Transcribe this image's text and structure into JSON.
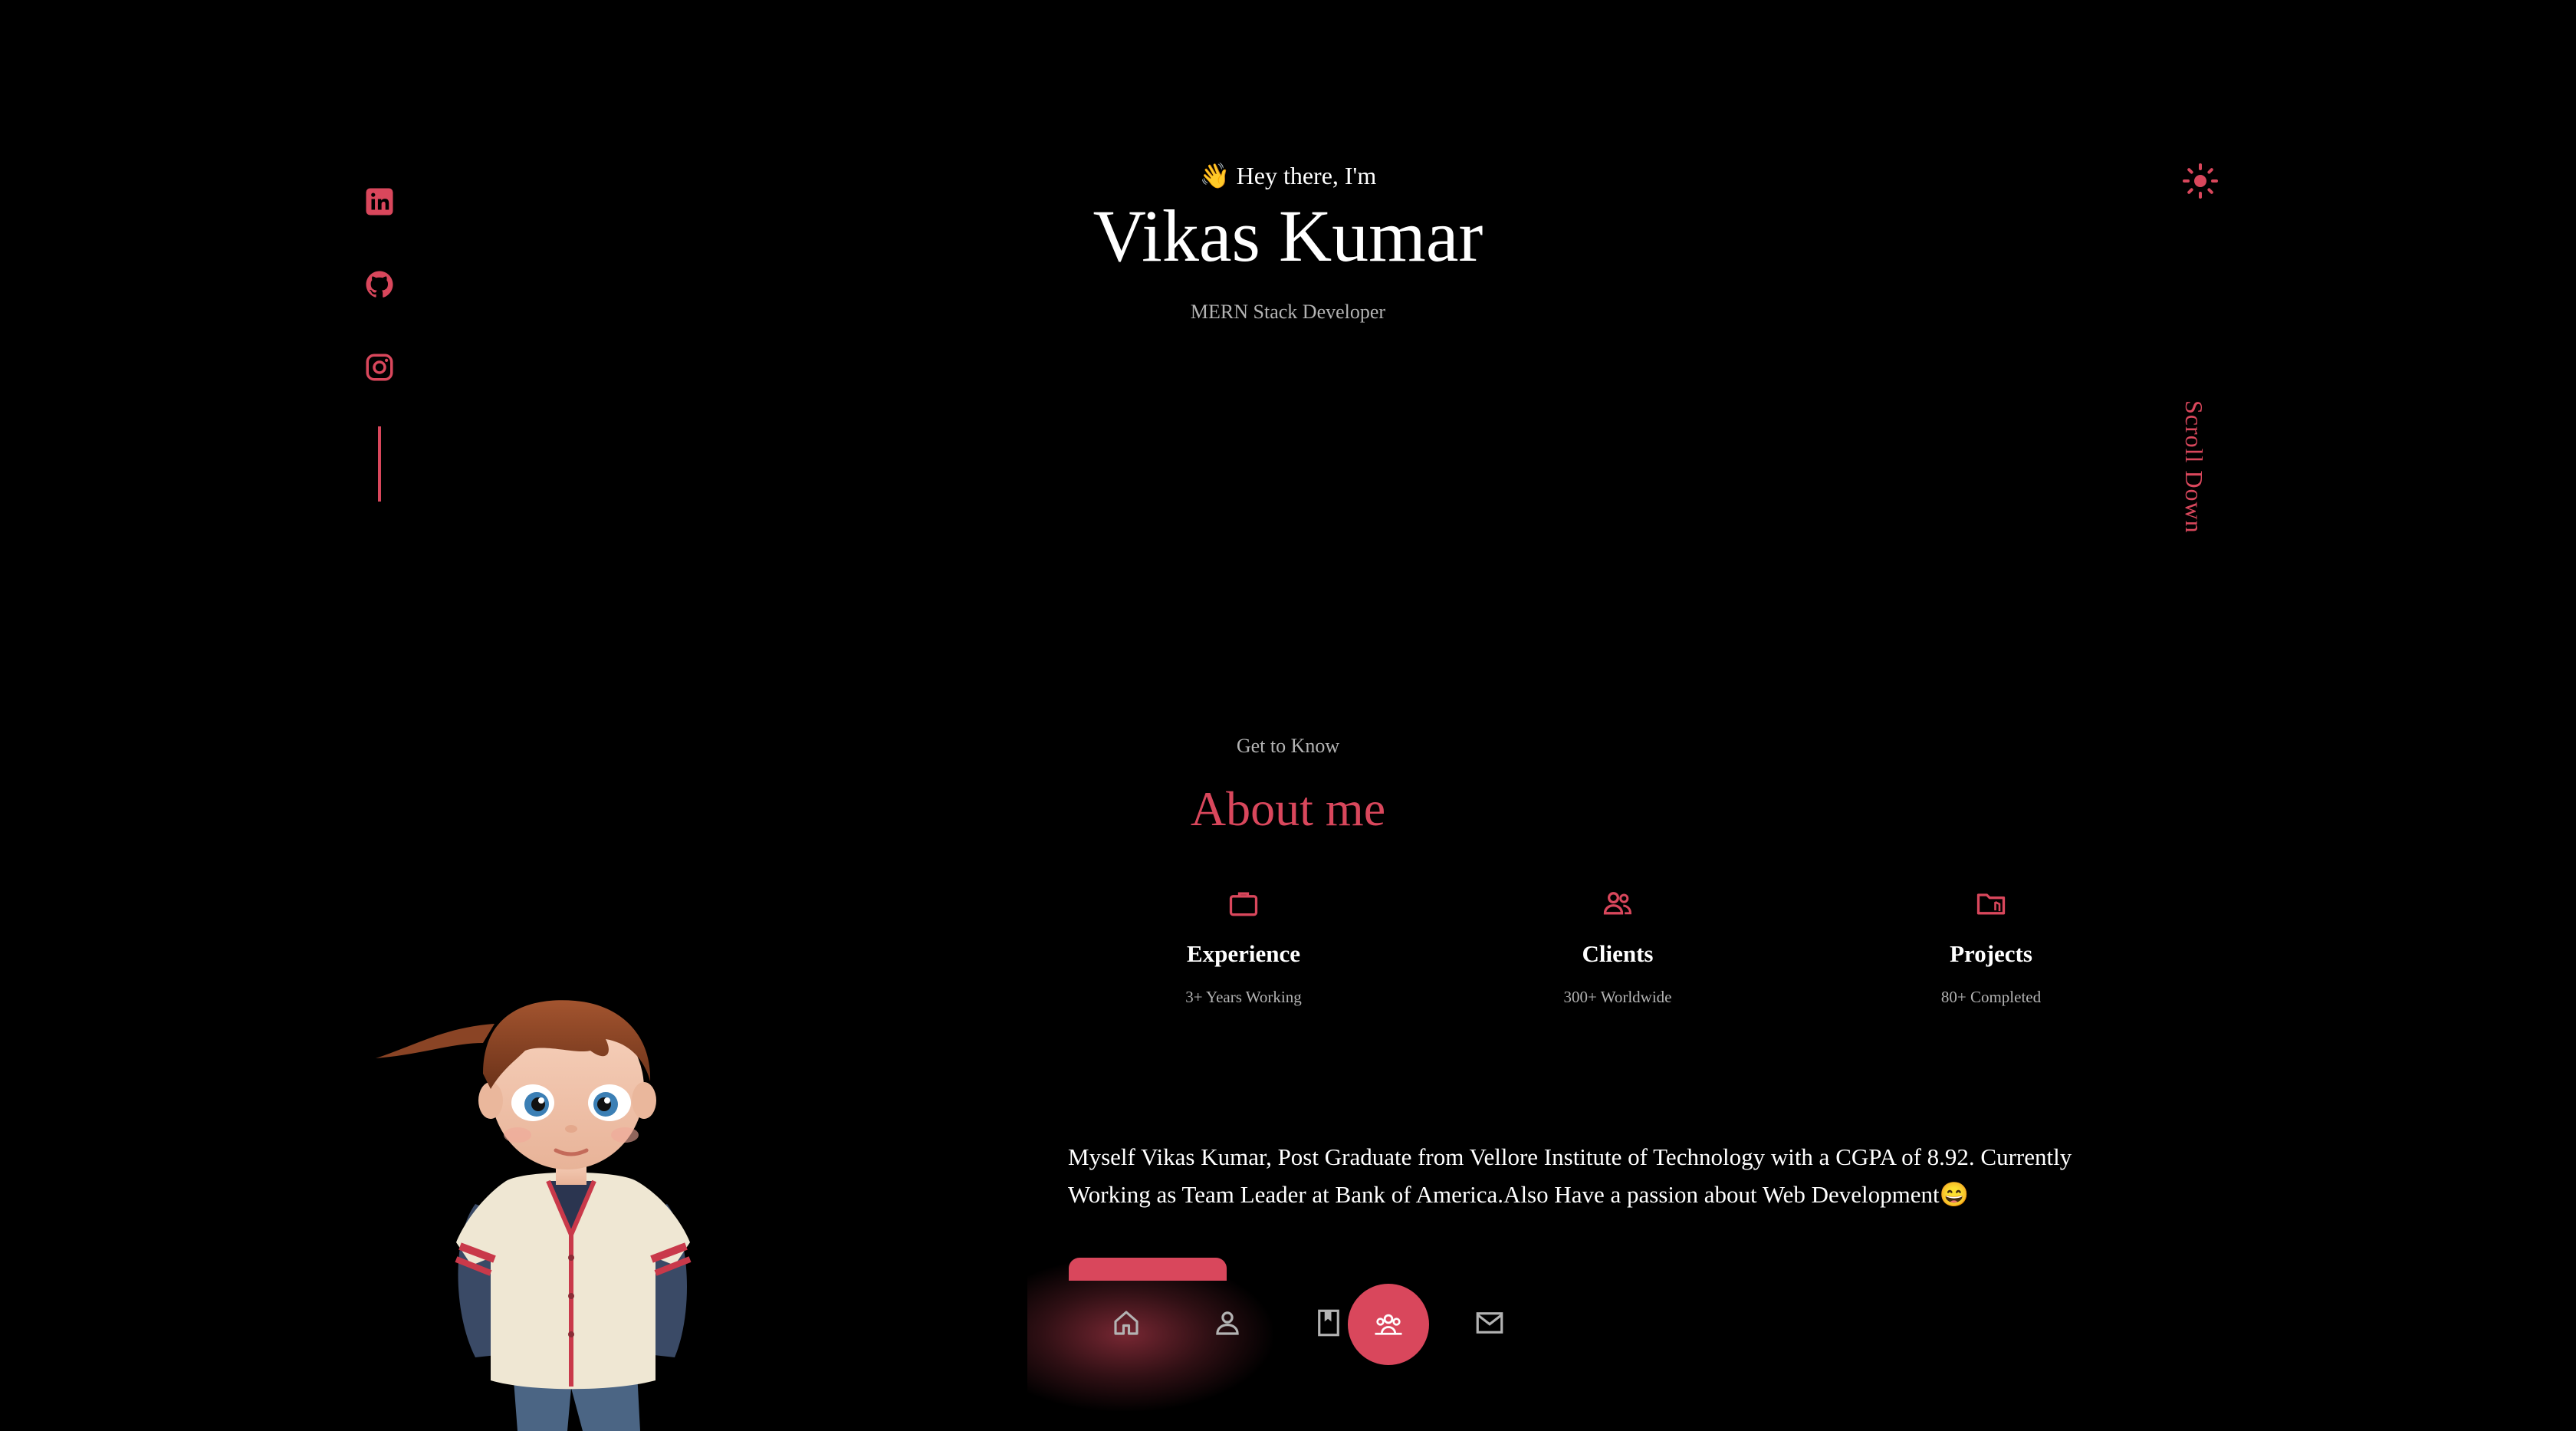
{
  "hero": {
    "greeting_emoji": "👋",
    "greeting": "Hey there, I'm",
    "name": "Vikas Kumar",
    "role": "MERN Stack Developer"
  },
  "social": [
    "linkedin-icon",
    "github-icon",
    "instagram-icon"
  ],
  "scroll_label": "Scroll Down",
  "about": {
    "subtitle": "Get to Know",
    "title": "About me",
    "cards": [
      {
        "icon": "briefcase-icon",
        "title": "Experience",
        "subtitle": "3+ Years Working"
      },
      {
        "icon": "users-icon",
        "title": "Clients",
        "subtitle": "300+ Worldwide"
      },
      {
        "icon": "folder-icon",
        "title": "Projects",
        "subtitle": "80+ Completed"
      }
    ],
    "bio": "Myself Vikas Kumar, Post Graduate from Vellore Institute of Technology with a CGPA of 8.92. Currently Working as Team Leader at Bank of America.Also Have a passion about Web Development😄"
  },
  "nav": {
    "items": [
      "home-icon",
      "user-icon",
      "bookmark-icon",
      "services-icon",
      "mail-icon"
    ],
    "active": "services-icon"
  },
  "colors": {
    "accent": "#d9475c",
    "background": "#000000",
    "muted_text": "#b3b3b3"
  }
}
